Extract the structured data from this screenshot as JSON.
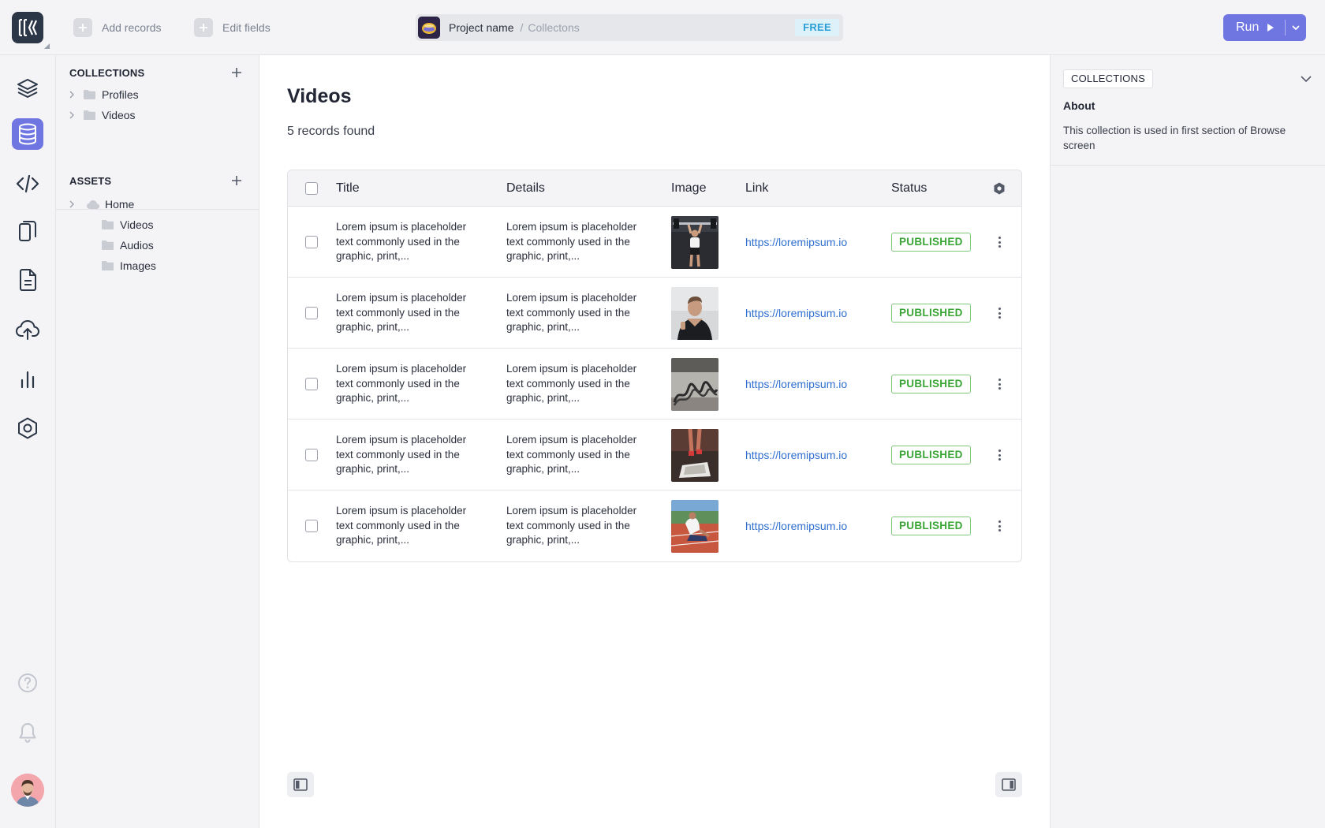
{
  "topbar": {
    "add_records": "Add records",
    "edit_fields": "Edit fields",
    "project_name": "Project name",
    "breadcrumb_separator": "/",
    "breadcrumb_current": "Collectons",
    "plan_badge": "FREE",
    "run_label": "Run"
  },
  "rail": {
    "items": [
      "layers-icon",
      "database-icon",
      "code-icon",
      "devices-icon",
      "document-icon",
      "upload-cloud-icon",
      "analytics-icon",
      "settings-hexagon-icon"
    ],
    "active": "database-icon",
    "bottom": [
      "help-icon",
      "bell-icon",
      "user-avatar"
    ]
  },
  "tree": {
    "collections_title": "COLLECTIONS",
    "collections": [
      {
        "label": "Profiles"
      },
      {
        "label": "Videos"
      }
    ],
    "assets_title": "ASSETS",
    "assets_root": "Home",
    "assets_children": [
      {
        "label": "Videos"
      },
      {
        "label": "Audios"
      },
      {
        "label": "Images"
      }
    ]
  },
  "main": {
    "title": "Videos",
    "record_count": "5 records found",
    "columns": {
      "title": "Title",
      "details": "Details",
      "image": "Image",
      "link": "Link",
      "status": "Status"
    },
    "rows": [
      {
        "title": "Lorem ipsum is placeholder text commonly used in the graphic, print,...",
        "details": "Lorem ipsum is placeholder text commonly used in the graphic, print,...",
        "link": "https://loremipsum.io",
        "status": "PUBLISHED"
      },
      {
        "title": "Lorem ipsum is placeholder text commonly used in the graphic, print,...",
        "details": "Lorem ipsum is placeholder text commonly used in the graphic, print,...",
        "link": "https://loremipsum.io",
        "status": "PUBLISHED"
      },
      {
        "title": "Lorem ipsum is placeholder text commonly used in the graphic, print,...",
        "details": "Lorem ipsum is placeholder text commonly used in the graphic, print,...",
        "link": "https://loremipsum.io",
        "status": "PUBLISHED"
      },
      {
        "title": "Lorem ipsum is placeholder text commonly used in the graphic, print,...",
        "details": "Lorem ipsum is placeholder text commonly used in the graphic, print,...",
        "link": "https://loremipsum.io",
        "status": "PUBLISHED"
      },
      {
        "title": "Lorem ipsum is placeholder text commonly used in the graphic, print,...",
        "details": "Lorem ipsum is placeholder text commonly used in the graphic, print,...",
        "link": "https://loremipsum.io",
        "status": "PUBLISHED"
      }
    ]
  },
  "right_panel": {
    "tag": "COLLECTIONS",
    "about_heading": "About",
    "description": "This collection is used in first section of Browse screen"
  },
  "colors": {
    "accent": "#6f76e2",
    "status_green": "#38a534",
    "link_blue": "#2f6fd0",
    "free_badge": "#2b9fd6"
  }
}
